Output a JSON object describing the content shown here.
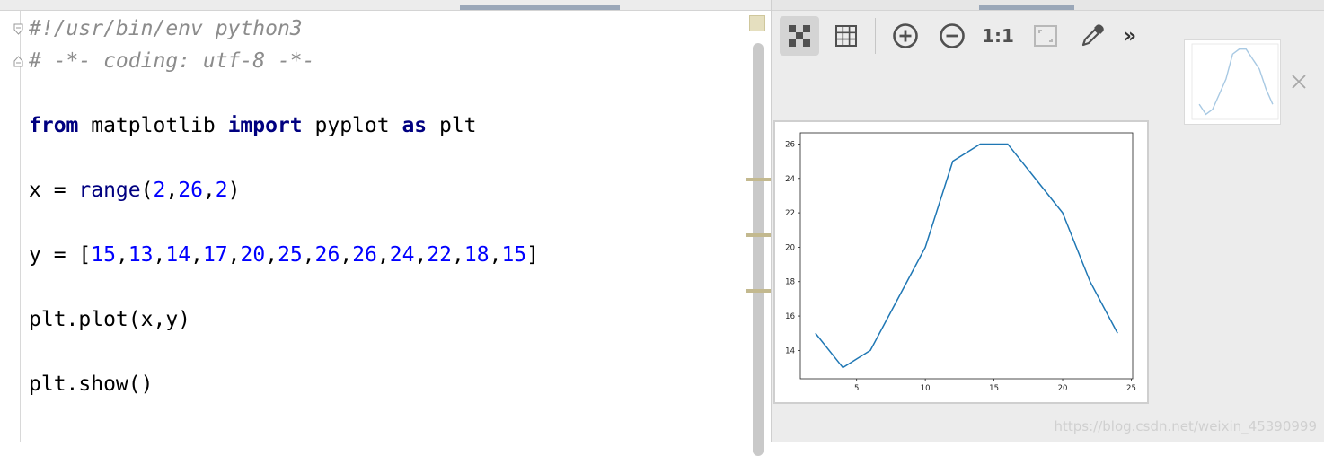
{
  "editor": {
    "shebang": "#!/usr/bin/env python3",
    "coding": "# -*- coding: utf-8 -*-",
    "import_line": {
      "from_kw": "from",
      "module": " matplotlib ",
      "import_kw": "import",
      "name": " pyplot ",
      "as_kw": "as",
      "alias": " plt"
    },
    "x_line": {
      "lhs": "x = ",
      "func": "range",
      "open": "(",
      "a": "2",
      "c1": ",",
      "b": "26",
      "c2": ",",
      "c": "2",
      "close": ")"
    },
    "y_line": {
      "lhs": "y = [",
      "values": [
        "15",
        "13",
        "14",
        "17",
        "20",
        "25",
        "26",
        "26",
        "24",
        "22",
        "18",
        "15"
      ],
      "close": "]"
    },
    "plot_call": "plt.plot(x,y)",
    "show_call": "plt.show()"
  },
  "viewer": {
    "toolbar": {
      "chessboard": "chessboard-icon",
      "grid": "grid-icon",
      "zoom_in": "zoom-in-icon",
      "zoom_out": "zoom-out-icon",
      "actual_size_label": "1:1",
      "fit": "fit-window-icon",
      "picker": "color-picker-icon",
      "overflow_label": "»"
    },
    "watermark": "https://blog.csdn.net/weixin_45390999"
  },
  "chart_data": {
    "type": "line",
    "x": [
      2,
      4,
      6,
      8,
      10,
      12,
      14,
      16,
      18,
      20,
      22,
      24
    ],
    "series": [
      {
        "values": [
          15,
          13,
          14,
          17,
          20,
          25,
          26,
          26,
          24,
          22,
          18,
          15
        ]
      }
    ],
    "xticks": [
      "5",
      "10",
      "15",
      "20",
      "25"
    ],
    "yticks": [
      "14",
      "16",
      "18",
      "20",
      "22",
      "24",
      "26"
    ],
    "xlim": [
      0.9,
      25.1
    ],
    "ylim": [
      12.35,
      26.65
    ],
    "grid": false,
    "line_color": "#1f77b4"
  }
}
